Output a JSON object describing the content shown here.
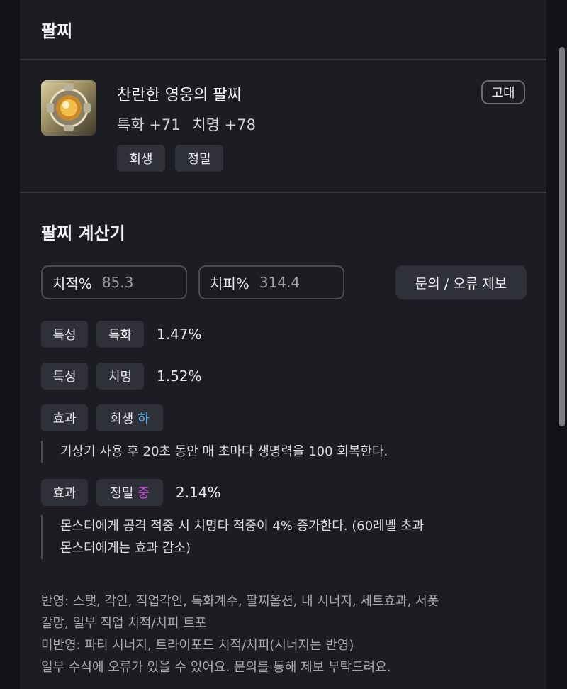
{
  "header": {
    "title": "팔찌"
  },
  "item": {
    "name": "찬란한 영웅의 팔찌",
    "grade": "고대",
    "stats": [
      {
        "label": "특화 +71"
      },
      {
        "label": "치명 +78"
      }
    ],
    "tags": [
      "회생",
      "정밀"
    ],
    "icon": "bracelet-icon"
  },
  "calculator": {
    "title": "팔찌 계산기",
    "crit_rate": {
      "label": "치적%",
      "value": "85.3"
    },
    "crit_damage": {
      "label": "치피%",
      "value": "314.4"
    },
    "report_button": "문의 / 오류 제보",
    "rows": [
      {
        "kind": "특성",
        "name": "특화",
        "grade": "",
        "value": "1.47%"
      },
      {
        "kind": "특성",
        "name": "치명",
        "grade": "",
        "value": "1.52%"
      },
      {
        "kind": "효과",
        "name": "회생",
        "grade": "하",
        "value": "",
        "desc": [
          "기상기 사용 후 20초 동안 매 초마다 생명력을 100 회복한다."
        ]
      },
      {
        "kind": "효과",
        "name": "정밀",
        "grade": "중",
        "value": "2.14%",
        "desc": [
          "몬스터에게 공격 적중 시 치명타 적중이 4% 증가한다. (60레벨 초과",
          "몬스터에게는 효과 감소)"
        ]
      }
    ]
  },
  "footer": {
    "lines": [
      "반영: 스탯, 각인, 직업각인, 특화계수, 팔찌옵션, 내 시너지, 세트효과, 서폿",
      "갈망, 일부 직업 치적/치피 트포",
      "미반영: 파티 시너지, 트라이포드 치적/치피(시너지는 반영)",
      "일부 수식에 오류가 있을 수 있어요. 문의를 통해 제보 부탁드려요."
    ]
  },
  "colors": {
    "background": "#121317",
    "panel": "#1c1d23",
    "grade_low": "#5bb6f0",
    "grade_mid": "#d24ee0"
  }
}
